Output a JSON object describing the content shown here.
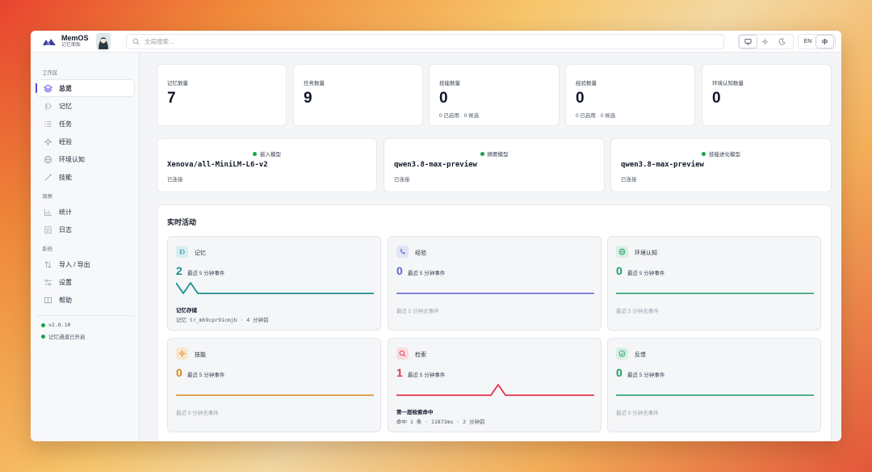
{
  "brand": {
    "name": "MemOS",
    "subtitle": "记忆面板"
  },
  "search": {
    "placeholder": "全局搜索..."
  },
  "lang": {
    "en": "EN",
    "zh": "中"
  },
  "sidebar": {
    "sections": [
      "工作区",
      "洞察",
      "系统"
    ],
    "items": [
      {
        "label": "总览",
        "icon": "layers-icon"
      },
      {
        "label": "记忆",
        "icon": "memory-icon"
      },
      {
        "label": "任务",
        "icon": "list-icon"
      },
      {
        "label": "经验",
        "icon": "sparkle-icon"
      },
      {
        "label": "环境认知",
        "icon": "globe-icon"
      },
      {
        "label": "技能",
        "icon": "wand-icon"
      },
      {
        "label": "统计",
        "icon": "chart-icon"
      },
      {
        "label": "日志",
        "icon": "log-icon"
      },
      {
        "label": "导入 / 导出",
        "icon": "transfer-icon"
      },
      {
        "label": "设置",
        "icon": "settings-icon"
      },
      {
        "label": "帮助",
        "icon": "book-icon"
      }
    ],
    "version": "v2.0.10",
    "channel_status": "记忆通道已开启"
  },
  "stats": [
    {
      "label": "记忆数量",
      "value": "7",
      "sub": ""
    },
    {
      "label": "任务数量",
      "value": "9",
      "sub": ""
    },
    {
      "label": "技能数量",
      "value": "0",
      "sub": "0 已启用 · 0 候选"
    },
    {
      "label": "经验数量",
      "value": "0",
      "sub": "0 已启用 · 0 候选"
    },
    {
      "label": "环境认知数量",
      "value": "0",
      "sub": ""
    }
  ],
  "models": [
    {
      "tag": "嵌入模型",
      "name": "Xenova/all-MiniLM-L6-v2",
      "status": "已连接"
    },
    {
      "tag": "摘要模型",
      "name": "qwen3.8-max-preview",
      "status": "已连接"
    },
    {
      "tag": "技能进化模型",
      "name": "qwen3.8-max-preview",
      "status": "已连接"
    }
  ],
  "activity": {
    "title": "实时活动",
    "cards": [
      {
        "name": "记忆",
        "icon": "memory-icon",
        "count": "2",
        "desc": "最近 5 分钟事件",
        "color": "#1a8f8f",
        "empty": "",
        "event_title": "记忆存储",
        "event_meta": "记忆 tr_mh9cpr91cmjb · 4 分钟前"
      },
      {
        "name": "经验",
        "icon": "sparkle-icon",
        "count": "0",
        "desc": "最近 5 分钟事件",
        "color": "#5b63d6",
        "empty": "最近 5 分钟无事件",
        "event_title": "",
        "event_meta": ""
      },
      {
        "name": "环境认知",
        "icon": "globe-icon",
        "count": "0",
        "desc": "最近 5 分钟事件",
        "color": "#1f9a6b",
        "empty": "最近 5 分钟无事件",
        "event_title": "",
        "event_meta": ""
      },
      {
        "name": "技能",
        "icon": "wand-icon",
        "count": "0",
        "desc": "最近 5 分钟事件",
        "color": "#d9861c",
        "empty": "最近 5 分钟无事件",
        "event_title": "",
        "event_meta": ""
      },
      {
        "name": "检索",
        "icon": "search-icon",
        "count": "1",
        "desc": "最近 5 分钟事件",
        "color": "#e0344e",
        "empty": "",
        "event_title": "第一层检索命中",
        "event_meta": "命中 1 条 · 11873ms · 2 分钟前"
      },
      {
        "name": "反馈",
        "icon": "check-circle-icon",
        "count": "0",
        "desc": "最近 5 分钟事件",
        "color": "#179a5f",
        "empty": "最近 5 分钟无事件",
        "event_title": "",
        "event_meta": ""
      }
    ]
  }
}
